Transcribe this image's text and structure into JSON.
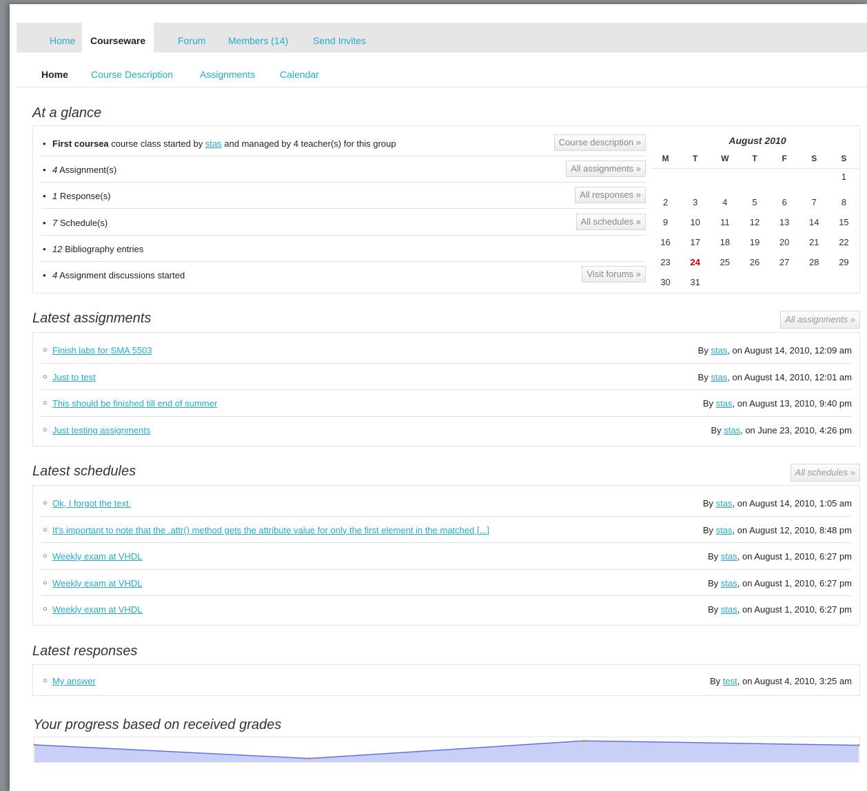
{
  "tabs": [
    {
      "label": "Home"
    },
    {
      "label": "Courseware"
    },
    {
      "label": "Forum"
    },
    {
      "label": "Members (14)"
    },
    {
      "label": "Send Invites"
    }
  ],
  "subnav": [
    {
      "label": "Home"
    },
    {
      "label": "Course Description"
    },
    {
      "label": "Assignments"
    },
    {
      "label": "Calendar"
    }
  ],
  "glance": {
    "title": "At a glance",
    "line1": {
      "bold": "First coursea",
      "mid": " course class started by ",
      "user": "stas",
      "rest": " and managed by 4 teacher(s) for this group",
      "button": "Course description »"
    },
    "items": [
      {
        "count": "4",
        "label": " Assignment(s)",
        "button": "All assignments »"
      },
      {
        "count": "1",
        "label": " Response(s)",
        "button": "All responses »"
      },
      {
        "count": "7",
        "label": " Schedule(s)",
        "button": "All schedules »"
      },
      {
        "count": "12",
        "label": " Bibliography entries",
        "button": ""
      },
      {
        "count": "4",
        "label": " Assignment discussions started",
        "button": "Visit forums »"
      }
    ]
  },
  "calendar": {
    "title": "August 2010",
    "weekdays": [
      "M",
      "T",
      "W",
      "T",
      "F",
      "S",
      "S"
    ],
    "weeks": [
      [
        "",
        "",
        "",
        "",
        "",
        "",
        "1"
      ],
      [
        "2",
        "3",
        "4",
        "5",
        "6",
        "7",
        "8"
      ],
      [
        "9",
        "10",
        "11",
        "12",
        "13",
        "14",
        "15"
      ],
      [
        "16",
        "17",
        "18",
        "19",
        "20",
        "21",
        "22"
      ],
      [
        "23",
        "24",
        "25",
        "26",
        "27",
        "28",
        "29"
      ],
      [
        "30",
        "31",
        "",
        "",
        "",
        "",
        ""
      ]
    ],
    "today": "24"
  },
  "assignments": {
    "title": "Latest assignments",
    "button": "All assignments »",
    "items": [
      {
        "title": "Finish labs for SMA 5503",
        "by": "By ",
        "user": "stas",
        "date": ", on August 14, 2010, 12:09 am"
      },
      {
        "title": "Just to test",
        "by": "By ",
        "user": "stas",
        "date": ", on August 14, 2010, 12:01 am"
      },
      {
        "title": "This should be finished till end of summer",
        "by": "By ",
        "user": "stas",
        "date": ", on August 13, 2010, 9:40 pm"
      },
      {
        "title": "Just testing assignments",
        "by": "By ",
        "user": "stas",
        "date": ", on June 23, 2010, 4:26 pm"
      }
    ]
  },
  "schedules": {
    "title": "Latest schedules",
    "button": "All schedules »",
    "items": [
      {
        "title": "Ok, I forgot the text.",
        "by": "By ",
        "user": "stas",
        "date": ", on August 14, 2010, 1:05 am"
      },
      {
        "title": "It's important to note that the .attr() method gets the attribute value for only the first element in the matched [...]",
        "by": "By ",
        "user": "stas",
        "date": ", on August 12, 2010, 8:48 pm"
      },
      {
        "title": "Weekly exam at VHDL",
        "by": "By ",
        "user": "stas",
        "date": ", on August 1, 2010, 6:27 pm"
      },
      {
        "title": "Weekly exam at VHDL",
        "by": "By ",
        "user": "stas",
        "date": ", on August 1, 2010, 6:27 pm"
      },
      {
        "title": "Weekly exam at VHDL",
        "by": "By ",
        "user": "stas",
        "date": ", on August 1, 2010, 6:27 pm"
      }
    ]
  },
  "responses": {
    "title": "Latest responses",
    "items": [
      {
        "title": " My answer",
        "by": "By ",
        "user": "test",
        "date": ", on August 4, 2010, 3:25 am"
      }
    ]
  },
  "progress": {
    "title": "Your progress based on received grades"
  },
  "chart_data": {
    "type": "area",
    "x": [
      1,
      2,
      3,
      4
    ],
    "values": [
      0.72,
      0.1,
      0.9,
      0.7
    ],
    "ylim": [
      0,
      1
    ],
    "colors": {
      "line": "#6070e0",
      "fill": "#c8d0f8",
      "point": "#f08020"
    }
  }
}
